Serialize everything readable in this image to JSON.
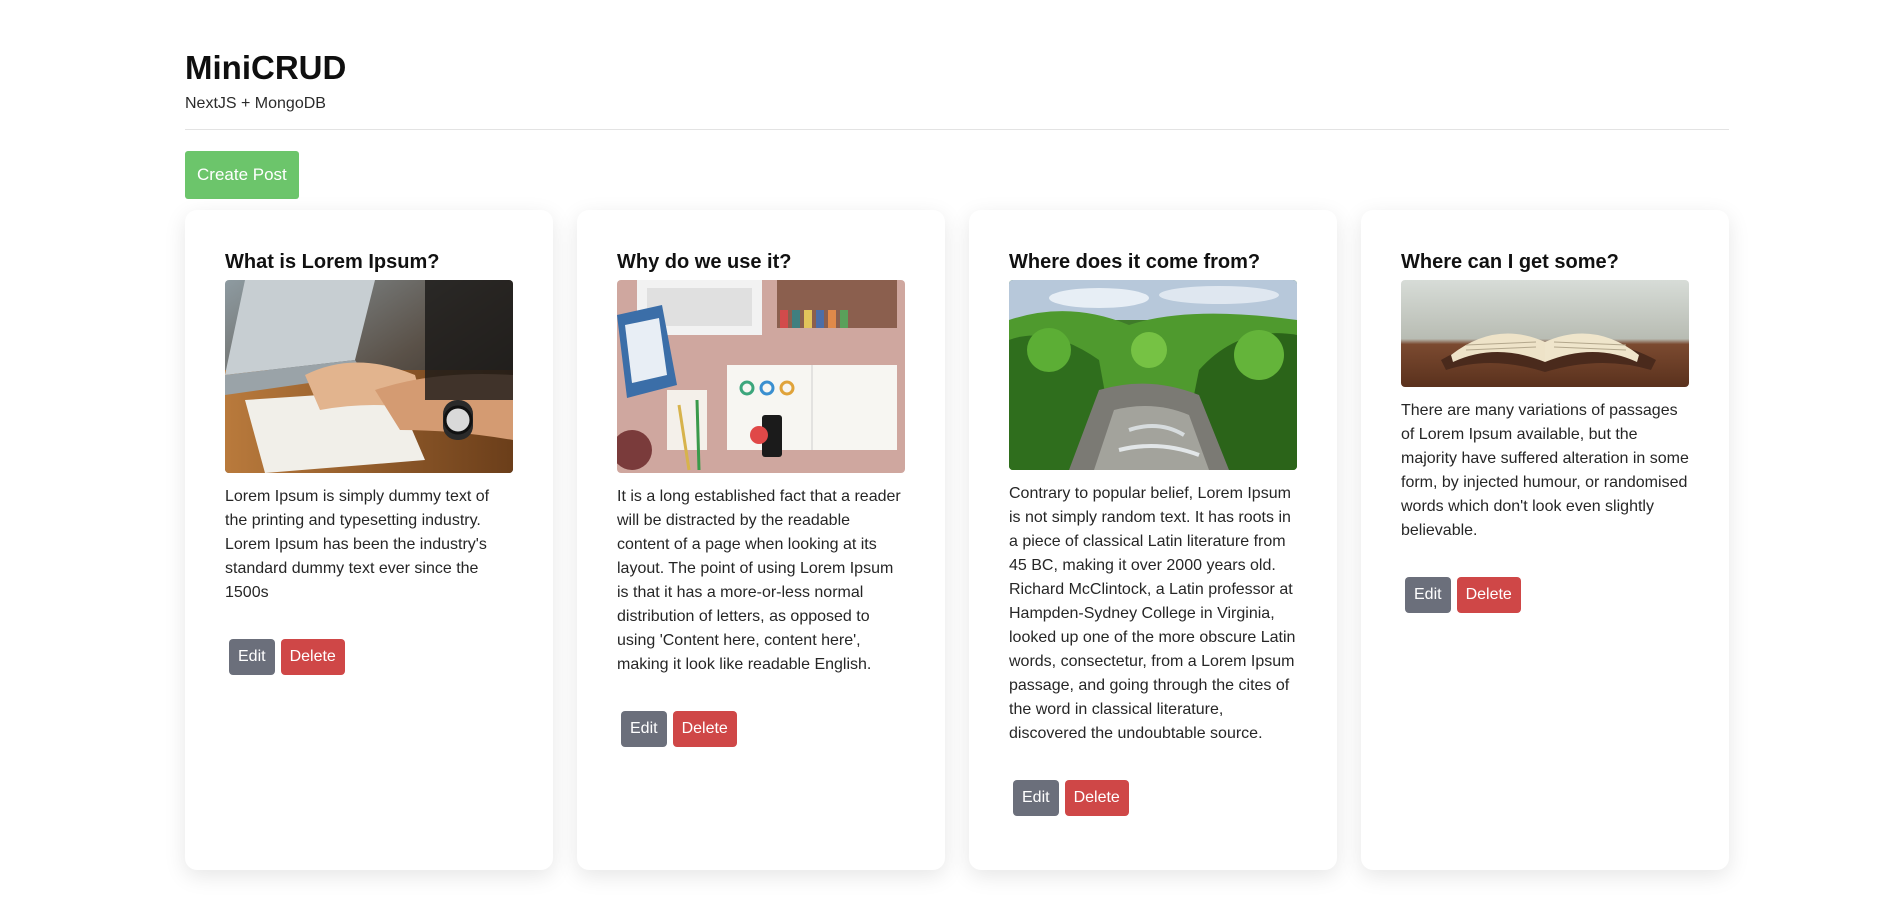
{
  "app": {
    "title": "MiniCRUD",
    "subtitle": "NextJS + MongoDB"
  },
  "toolbar": {
    "create_label": "Create Post"
  },
  "colors": {
    "create": "#6cc56b",
    "edit": "#6b6f7b",
    "delete": "#cf4747"
  },
  "posts": [
    {
      "title": "What is Lorem Ipsum?",
      "image": "laptop-hands-notebook-photo",
      "body": "Lorem Ipsum is simply dummy text of the printing and typesetting industry. Lorem Ipsum has been the industry's standard dummy text ever since the 1500s",
      "edit_label": "Edit",
      "delete_label": "Delete"
    },
    {
      "title": "Why do we use it?",
      "image": "desk-flatlay-photo",
      "body": "It is a long established fact that a reader will be distracted by the readable content of a page when looking at its layout. The point of using Lorem Ipsum is that it has a more-or-less normal distribution of letters, as opposed to using 'Content here, content here', making it look like readable English.",
      "edit_label": "Edit",
      "delete_label": "Delete"
    },
    {
      "title": "Where does it come from?",
      "image": "forest-river-photo",
      "body": "Contrary to popular belief, Lorem Ipsum is not simply random text. It has roots in a piece of classical Latin literature from 45 BC, making it over 2000 years old. Richard McClintock, a Latin professor at Hampden-Sydney College in Virginia, looked up one of the more obscure Latin words, consectetur, from a Lorem Ipsum passage, and going through the cites of the word in classical literature, discovered the undoubtable source.",
      "edit_label": "Edit",
      "delete_label": "Delete"
    },
    {
      "title": "Where can I get some?",
      "image": "open-book-photo",
      "body": "There are many variations of passages of Lorem Ipsum available, but the majority have suffered alteration in some form, by injected humour, or randomised words which don't look even slightly believable.",
      "edit_label": "Edit",
      "delete_label": "Delete"
    }
  ]
}
